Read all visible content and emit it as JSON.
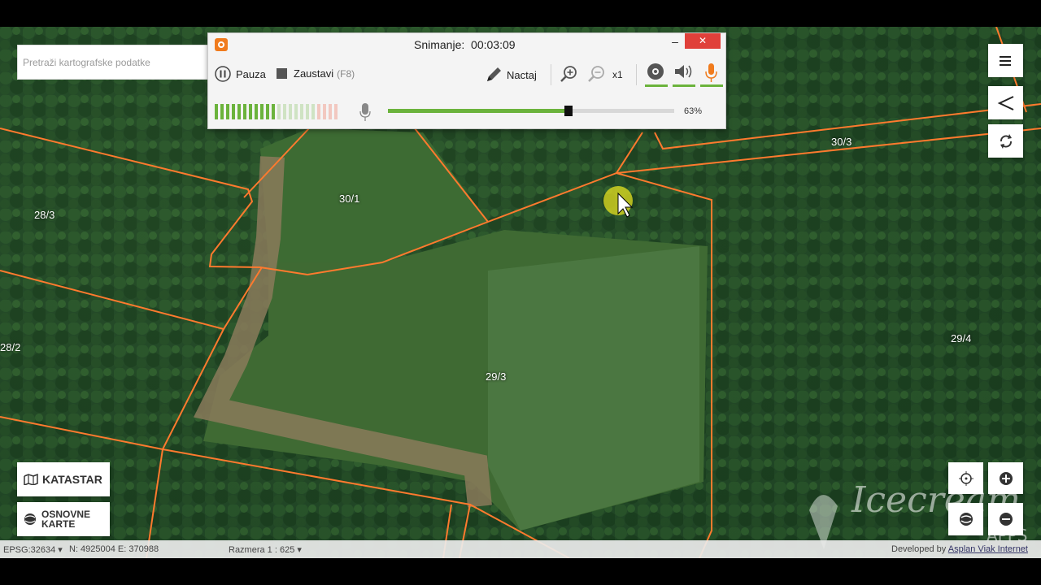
{
  "search": {
    "placeholder": "Pretraži kartografske podatke"
  },
  "parcels": [
    "30/3",
    "30/1",
    "28/3",
    "28/2",
    "29/3",
    "29/4"
  ],
  "layers": {
    "katastar": "KATASTAR",
    "osnovne_line1": "OSNOVNE",
    "osnovne_line2": "KARTE"
  },
  "status": {
    "epsg": "EPSG:32634 ▾",
    "coords": "N: 4925004 E: 370988",
    "scale": "Razmera 1 : 625 ▾",
    "dev_prefix": "Developed by",
    "dev_link": "Asplan Viak Internet"
  },
  "recorder": {
    "title_label": "Snimanje:",
    "time": "00:03:09",
    "pause_label": "Pauza",
    "stop_label": "Zaustavi",
    "stop_shortcut": "(F8)",
    "draw_label": "Nactaj",
    "zoom_level": "x1",
    "volume_percent": "63%",
    "volume_fraction": 0.63,
    "close_glyph": "✕",
    "minimize_glyph": "–"
  },
  "watermark": {
    "brand": "Icecream",
    "sub": "APPS"
  },
  "colors": {
    "parcel_line": "#ff7a2e",
    "accent_green": "#6bb33c",
    "close_red": "#e0403a",
    "recorder_orange": "#f07b1d"
  },
  "icons": [
    "search-icon",
    "menu-icon",
    "share-icon",
    "refresh-icon",
    "locate-icon",
    "zoom-in-icon",
    "zoom-out-icon",
    "map-icon",
    "globe-icon",
    "pause-icon",
    "stop-icon",
    "pencil-icon",
    "magnifier-plus-icon",
    "magnifier-minus-icon",
    "webcam-icon",
    "speaker-icon",
    "microphone-icon",
    "cursor-icon"
  ]
}
